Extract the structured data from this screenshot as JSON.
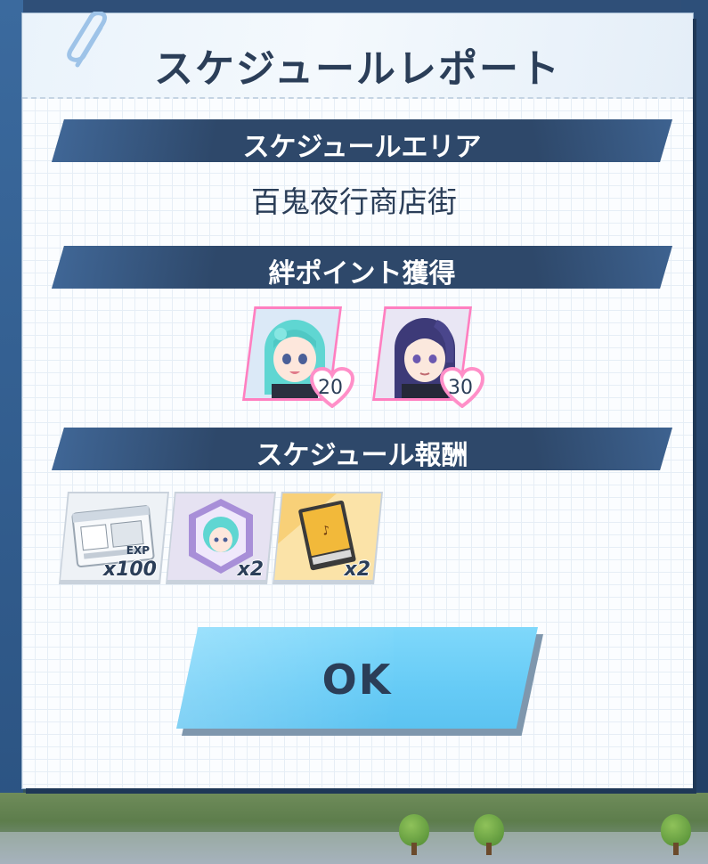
{
  "dialog": {
    "title": "スケジュールレポート"
  },
  "area_section": {
    "header": "スケジュールエリア",
    "area_name": "百鬼夜行商店街"
  },
  "bond_section": {
    "header": "絆ポイント獲得",
    "characters": [
      {
        "points": "20",
        "portrait": "teal-haired-student-portrait"
      },
      {
        "points": "30",
        "portrait": "navy-haired-student-portrait"
      }
    ]
  },
  "reward_section": {
    "header": "スケジュール報酬",
    "items": [
      {
        "icon": "exp-report-icon",
        "quantity": "x100"
      },
      {
        "icon": "character-eleph-icon",
        "quantity": "x2"
      },
      {
        "icon": "hyakkiyako-book-icon",
        "quantity": "x2"
      }
    ]
  },
  "ok_button": {
    "label": "OK"
  },
  "colors": {
    "header_bar": "#2e486a",
    "title_text": "#2b3e58",
    "ok_button": "#66cbf6",
    "bond_frame": "#ff7fc0"
  }
}
